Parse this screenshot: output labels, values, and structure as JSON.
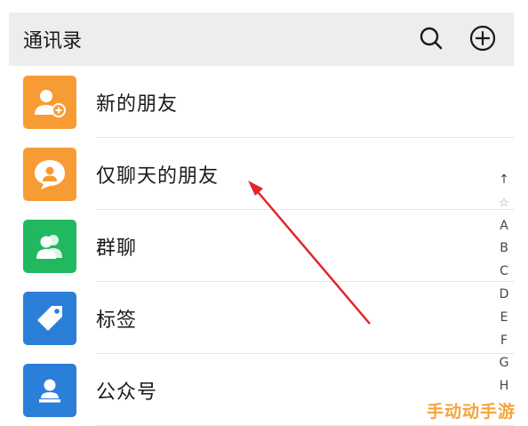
{
  "header": {
    "title": "通讯录",
    "search_icon": "search-icon",
    "add_icon": "add-circle-icon"
  },
  "items": [
    {
      "label": "新的朋友",
      "icon": "add-friend-icon",
      "color": "#f79c35"
    },
    {
      "label": "仅聊天的朋友",
      "icon": "chat-bubble-person-icon",
      "color": "#f79c35"
    },
    {
      "label": "群聊",
      "icon": "group-icon",
      "color": "#20b960"
    },
    {
      "label": "标签",
      "icon": "tag-icon",
      "color": "#2b7fd9"
    },
    {
      "label": "公众号",
      "icon": "official-account-icon",
      "color": "#2b7fd9"
    }
  ],
  "index_bar": {
    "up": "↑",
    "star": "☆",
    "letters": [
      "A",
      "B",
      "C",
      "D",
      "E",
      "F",
      "G",
      "H"
    ]
  },
  "annotation": {
    "arrow_color": "#e0262b"
  },
  "watermark": {
    "text": "手动动手游",
    "color": "#f4a53a"
  }
}
